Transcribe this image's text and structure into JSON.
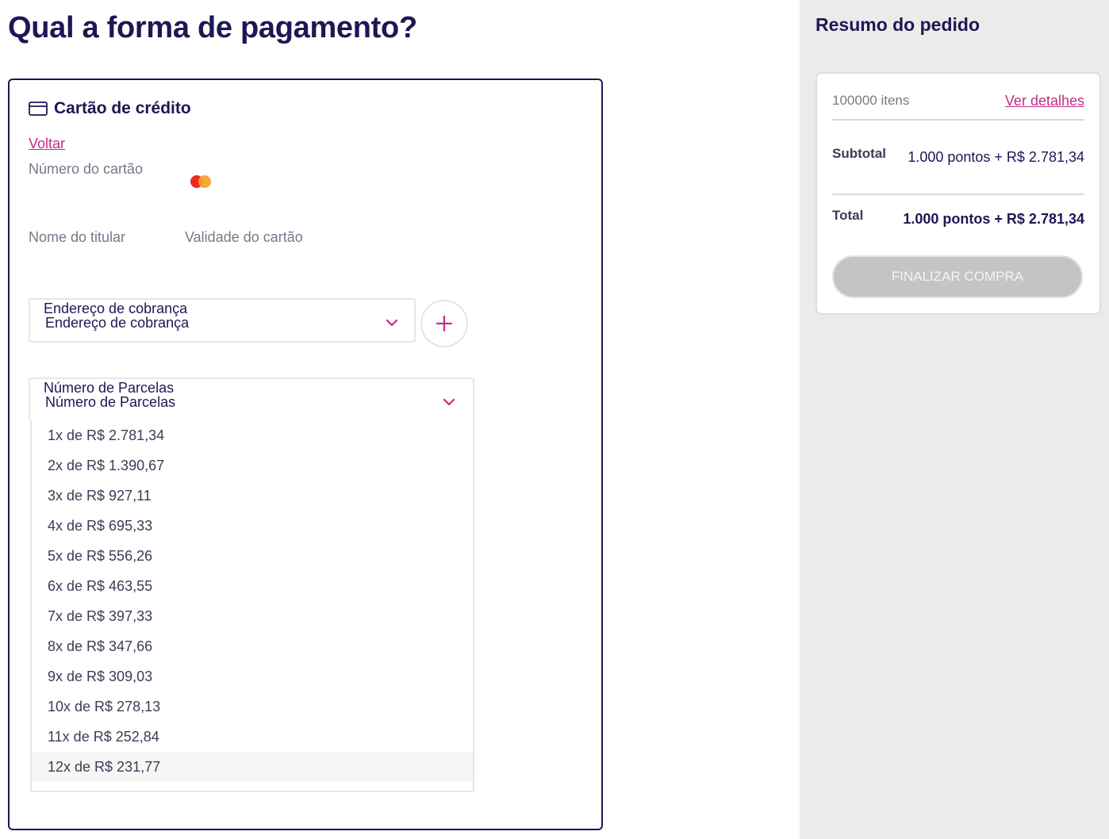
{
  "page": {
    "title": "Qual a forma de pagamento?"
  },
  "payment": {
    "method_title": "Cartão de crédito",
    "back_label": "Voltar",
    "card_number_label": "Número do cartão",
    "card_brand_icon": "mastercard-logo",
    "holder_name_label": "Nome do titular",
    "expiry_label": "Validade do cartão",
    "billing_address": {
      "label": "Endereço de cobrança",
      "value": "Endereço de cobrança",
      "add_icon": "plus-icon"
    },
    "installments": {
      "label": "Número de Parcelas",
      "value": "Número de Parcelas",
      "options": [
        "1x de R$ 2.781,34",
        "2x de R$ 1.390,67",
        "3x de R$ 927,11",
        "4x de R$ 695,33",
        "5x de R$ 556,26",
        "6x de R$ 463,55",
        "7x de R$ 397,33",
        "8x de R$ 347,66",
        "9x de R$ 309,03",
        "10x de R$ 278,13",
        "11x de R$ 252,84",
        "12x de R$ 231,77"
      ],
      "highlighted_option": "12x de R$ 231,77"
    }
  },
  "summary": {
    "title": "Resumo do pedido",
    "items_count": "100000 itens",
    "details_link": "Ver detalhes",
    "subtotal_label": "Subtotal",
    "subtotal_value": "1.000 pontos + R$ 2.781,34",
    "total_label": "Total",
    "total_value": "1.000 pontos + R$ 2.781,34",
    "finalize_label": "FINALIZAR COMPRA"
  },
  "colors": {
    "brand_navy": "#1c1854",
    "accent_magenta": "#c42a86",
    "panel_gray": "#ebebeb",
    "disabled_button": "#c4c4c4"
  }
}
